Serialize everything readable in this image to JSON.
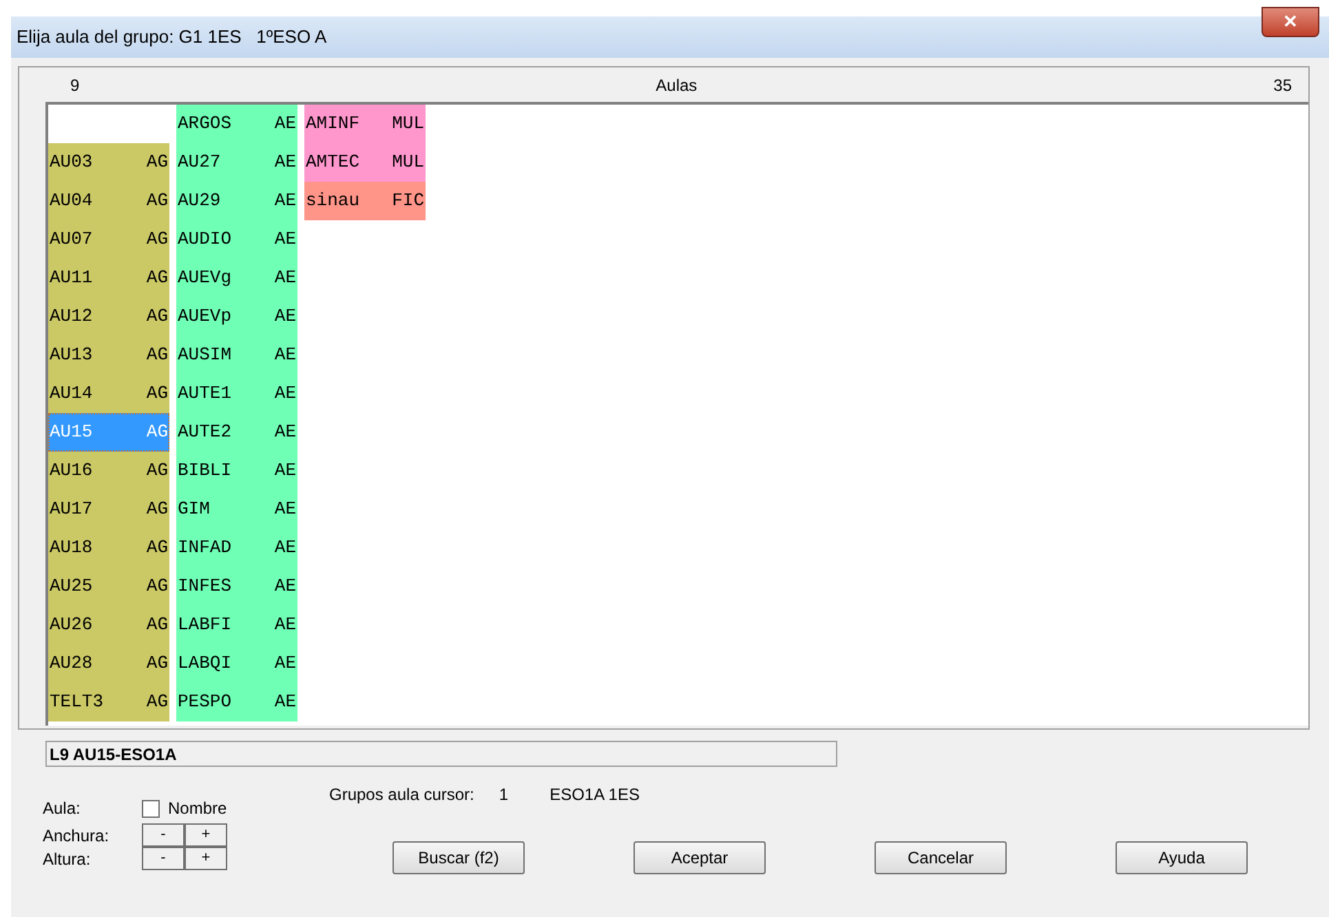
{
  "window": {
    "title": "Elija aula del grupo: G1 1ES   1ºESO A",
    "close": "✕"
  },
  "header": {
    "start": "9",
    "title": "Aulas",
    "end": "35"
  },
  "grid": {
    "columns": [
      {
        "starts_below_first_row": true,
        "blocks": [
          {
            "color": "#cbc866",
            "cells": [
              {
                "name": "AU03",
                "code": "AG",
                "selected": false
              },
              {
                "name": "AU04",
                "code": "AG",
                "selected": false
              },
              {
                "name": "AU07",
                "code": "AG",
                "selected": false
              },
              {
                "name": "AU11",
                "code": "AG",
                "selected": false
              },
              {
                "name": "AU12",
                "code": "AG",
                "selected": false
              },
              {
                "name": "AU13",
                "code": "AG",
                "selected": false
              },
              {
                "name": "AU14",
                "code": "AG",
                "selected": false
              },
              {
                "name": "AU15",
                "code": "AG",
                "selected": true
              },
              {
                "name": "AU16",
                "code": "AG",
                "selected": false
              },
              {
                "name": "AU17",
                "code": "AG",
                "selected": false
              },
              {
                "name": "AU18",
                "code": "AG",
                "selected": false
              },
              {
                "name": "AU25",
                "code": "AG",
                "selected": false
              },
              {
                "name": "AU26",
                "code": "AG",
                "selected": false
              },
              {
                "name": "AU28",
                "code": "AG",
                "selected": false
              },
              {
                "name": "TELT3",
                "code": "AG",
                "selected": false
              }
            ]
          }
        ]
      },
      {
        "blocks": [
          {
            "color": "#6fffb5",
            "cells": [
              {
                "name": "ARGOS",
                "code": "AE",
                "selected": false
              },
              {
                "name": "AU27",
                "code": "AE",
                "selected": false
              },
              {
                "name": "AU29",
                "code": "AE",
                "selected": false
              },
              {
                "name": "AUDIO",
                "code": "AE",
                "selected": false
              },
              {
                "name": "AUEVg",
                "code": "AE",
                "selected": false
              },
              {
                "name": "AUEVp",
                "code": "AE",
                "selected": false
              },
              {
                "name": "AUSIM",
                "code": "AE",
                "selected": false
              },
              {
                "name": "AUTE1",
                "code": "AE",
                "selected": false
              },
              {
                "name": "AUTE2",
                "code": "AE",
                "selected": false
              },
              {
                "name": "BIBLI",
                "code": "AE",
                "selected": false
              },
              {
                "name": "GIM",
                "code": "AE",
                "selected": false
              },
              {
                "name": "INFAD",
                "code": "AE",
                "selected": false
              },
              {
                "name": "INFES",
                "code": "AE",
                "selected": false
              },
              {
                "name": "LABFI",
                "code": "AE",
                "selected": false
              },
              {
                "name": "LABQI",
                "code": "AE",
                "selected": false
              },
              {
                "name": "PESPO",
                "code": "AE",
                "selected": false
              }
            ]
          }
        ]
      },
      {
        "blocks": [
          {
            "color": "#ff96cc",
            "cells": [
              {
                "name": "AMINF",
                "code": "MUL",
                "selected": false
              },
              {
                "name": "AMTEC",
                "code": "MUL",
                "selected": false
              }
            ]
          },
          {
            "color": "#ff9488",
            "cells": [
              {
                "name": "sinau",
                "code": "FIC",
                "selected": false
              }
            ]
          }
        ]
      }
    ]
  },
  "status": "L9 AU15-ESO1A",
  "aula": {
    "label": "Aula:",
    "checkbox": {
      "label": "Nombre",
      "checked": false
    }
  },
  "anchura": {
    "label": "Anchura:",
    "minus": "-",
    "plus": "+"
  },
  "altura": {
    "label": "Altura:",
    "minus": "-",
    "plus": "+"
  },
  "cursor_groups": {
    "label": "Grupos aula cursor:",
    "count": "1",
    "groups": "ESO1A 1ES"
  },
  "buttons": [
    "Buscar (f2)",
    "Aceptar",
    "Cancelar",
    "Ayuda"
  ]
}
